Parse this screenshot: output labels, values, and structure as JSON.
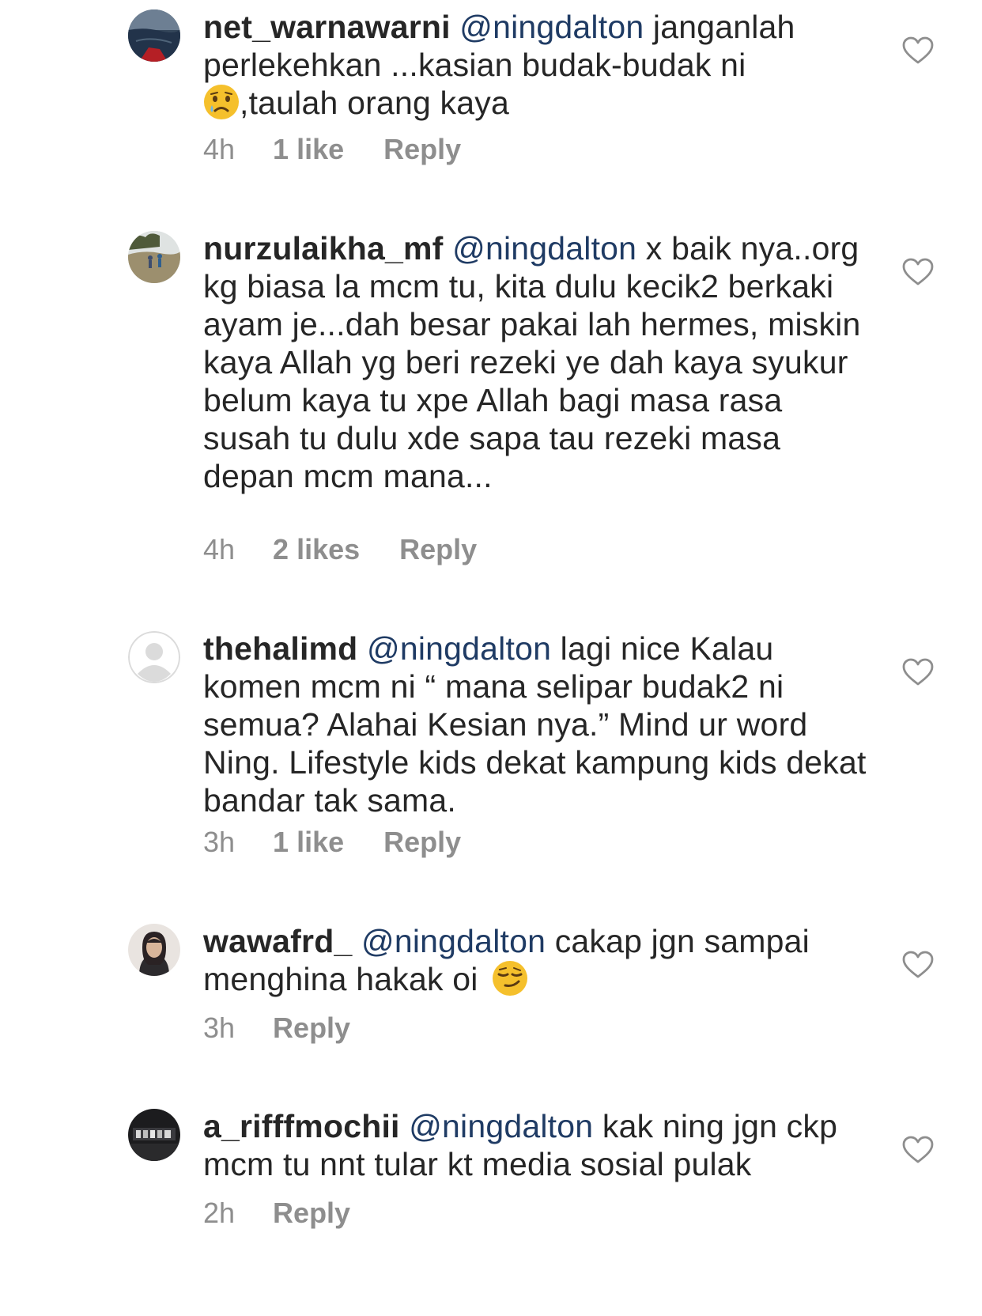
{
  "comments": [
    {
      "username": "net_warnawarni",
      "mention": "@ningdalton",
      "text_before_emoji": "janganlah perlekehkan ...kasian budak-budak ni",
      "emoji": "sad-face-emoji",
      "text_after_emoji": ",taulah orang kaya",
      "time": "4h",
      "likes": "1 like",
      "reply": "Reply"
    },
    {
      "username": "nurzulaikha_mf",
      "mention": "@ningdalton",
      "text": "x baik nya..org kg biasa la mcm tu, kita dulu kecik2 berkaki ayam je...dah besar pakai lah hermes, miskin kaya Allah yg beri rezeki ye dah kaya syukur belum kaya tu xpe Allah bagi masa rasa susah tu dulu xde sapa tau rezeki masa depan mcm mana...",
      "time": "4h",
      "likes": "2 likes",
      "reply": "Reply"
    },
    {
      "username": "thehalimd",
      "mention": "@ningdalton",
      "text": "lagi nice Kalau komen mcm ni “ mana selipar budak2 ni semua? Alahai Kesian nya.” Mind ur word Ning. Lifestyle kids dekat kampung kids dekat bandar tak sama.",
      "time": "3h",
      "likes": "1 like",
      "reply": "Reply"
    },
    {
      "username": "wawafrd_",
      "mention": "@ningdalton",
      "text": "cakap jgn sampai menghina hakak oi",
      "emoji": "smirk-face-emoji",
      "time": "3h",
      "reply": "Reply"
    },
    {
      "username": "a_rifffmochii",
      "mention": "@ningdalton",
      "text": "kak ning jgn ckp mcm tu nnt tular kt media sosial pulak",
      "time": "2h",
      "reply": "Reply"
    }
  ],
  "colors": {
    "text": "#262626",
    "mention": "#1f3b64",
    "meta": "#8e8e8e",
    "emoji_face": "#f5c02c"
  }
}
